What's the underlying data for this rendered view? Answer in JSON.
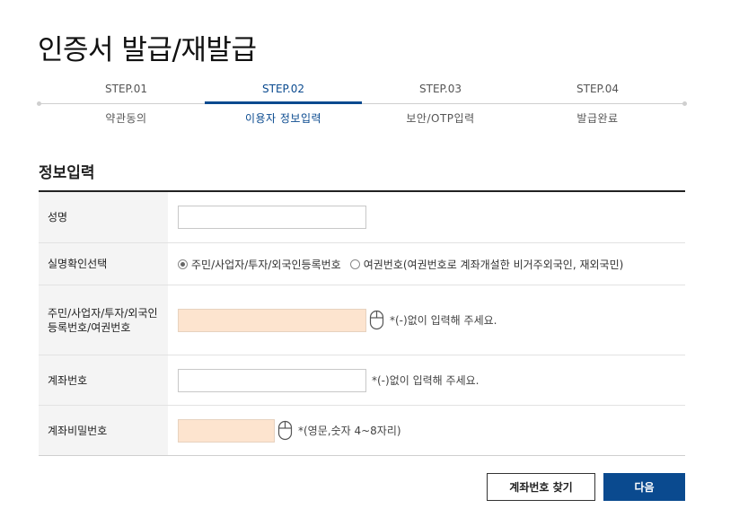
{
  "page": {
    "title": "인증서 발급/재발급"
  },
  "steps": [
    {
      "num": "STEP.01",
      "name": "약관동의",
      "active": false
    },
    {
      "num": "STEP.02",
      "name": "이용자 정보입력",
      "active": true
    },
    {
      "num": "STEP.03",
      "name": "보안/OTP입력",
      "active": false
    },
    {
      "num": "STEP.04",
      "name": "발급완료",
      "active": false
    }
  ],
  "section": {
    "title": "정보입력"
  },
  "form": {
    "name": {
      "label": "성명",
      "value": ""
    },
    "id_type": {
      "label": "실명확인선택",
      "options": [
        {
          "label": "주민/사업자/투자/외국인등록번호",
          "checked": true
        },
        {
          "label": "여권번호(여권번호로 계좌개설한 비거주외국인, 재외국민)",
          "checked": false
        }
      ]
    },
    "id_number": {
      "label": "주민/사업자/투자/외국인등록번호/여권번호",
      "value": "",
      "hint": "*(-)없이 입력해 주세요."
    },
    "account_number": {
      "label": "계좌번호",
      "value": "",
      "hint": "*(-)없이 입력해 주세요."
    },
    "account_password": {
      "label": "계좌비밀번호",
      "value": "",
      "hint": "*(영문,숫자 4~8자리)"
    }
  },
  "icons": {
    "secure_keypad": "mouse-icon"
  },
  "buttons": {
    "find_account": "계좌번호 찾기",
    "next": "다음"
  },
  "colors": {
    "accent": "#0a4a8f",
    "secure_input_bg": "#fde4cf"
  }
}
